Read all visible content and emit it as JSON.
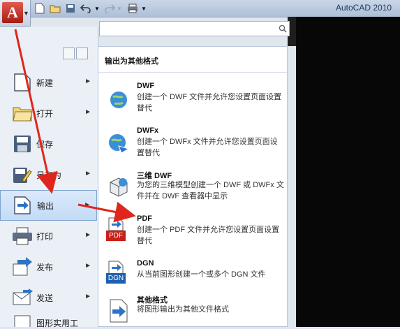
{
  "app": {
    "title": "AutoCAD 2010",
    "logo_letter": "A"
  },
  "search": {
    "placeholder": "",
    "value": ""
  },
  "menu_items": [
    {
      "label": "新建",
      "icon": "new-document-icon"
    },
    {
      "label": "打开",
      "icon": "open-folder-icon"
    },
    {
      "label": "保存",
      "icon": "save-disk-icon"
    },
    {
      "label": "另存为",
      "icon": "save-as-icon"
    },
    {
      "label": "输出",
      "icon": "export-icon"
    },
    {
      "label": "打印",
      "icon": "printer-icon"
    },
    {
      "label": "发布",
      "icon": "publish-icon"
    },
    {
      "label": "发送",
      "icon": "send-icon"
    },
    {
      "label": "图形实用工",
      "icon": "drawing-utilities-icon"
    }
  ],
  "submenu": {
    "header": "输出为其他格式",
    "items": [
      {
        "title": "DWF",
        "desc": "创建一个 DWF 文件并允许您设置页面设置替代"
      },
      {
        "title": "DWFx",
        "desc": "创建一个 DWFx 文件并允许您设置页面设置替代"
      },
      {
        "title": "三维 DWF",
        "desc": "为您的三维模型创建一个 DWF 或 DWFx 文件并在 DWF 查看器中显示"
      },
      {
        "title": "PDF",
        "desc": "创建一个 PDF 文件并允许您设置页面设置替代",
        "badge": "PDF"
      },
      {
        "title": "DGN",
        "desc": "从当前图形创建一个或多个 DGN 文件",
        "badge": "DGN"
      },
      {
        "title": "其他格式",
        "desc": "将图形输出为其他文件格式"
      }
    ]
  },
  "colors": {
    "accent_red": "#e0261c",
    "selected_bg": "#c3dbf6",
    "workspace": "#070707"
  }
}
